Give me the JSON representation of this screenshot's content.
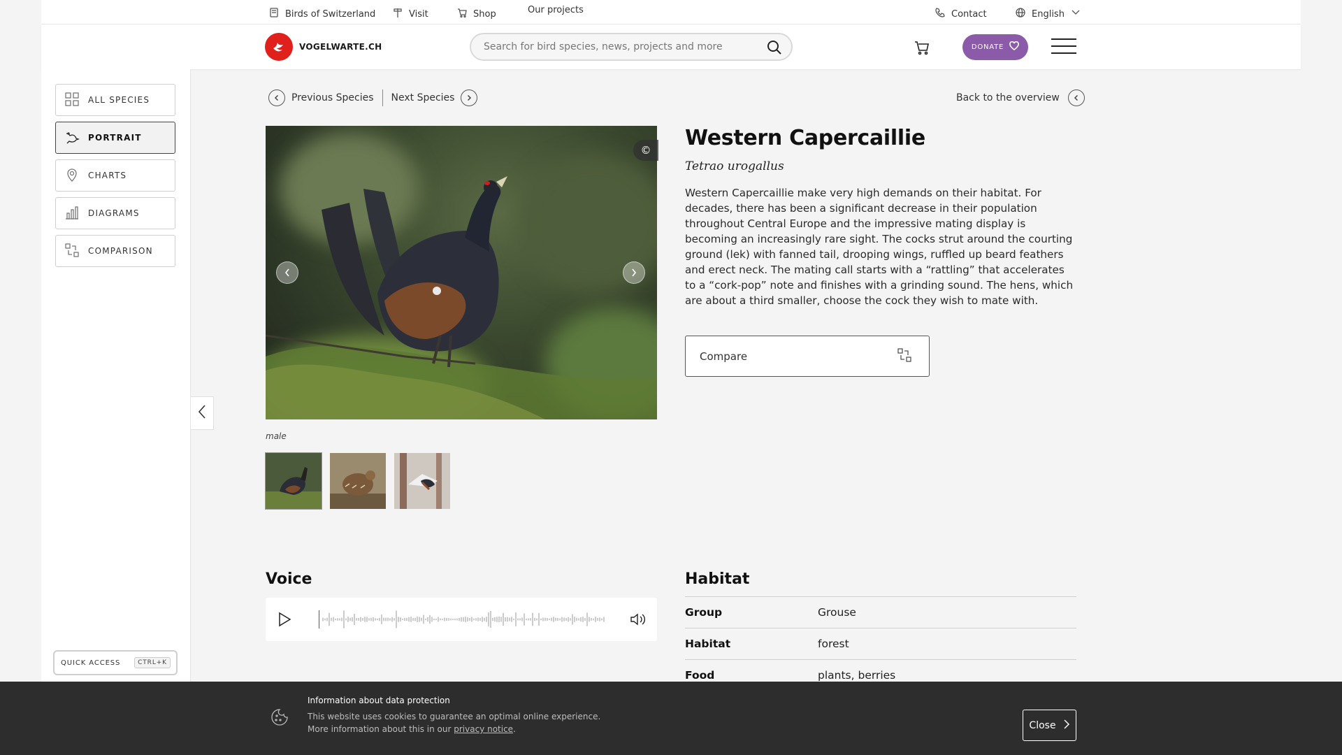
{
  "utility_bar": {
    "birds_of_switzerland": "Birds of Switzerland",
    "visit": "Visit",
    "shop": "Shop",
    "our_projects": "Our projects",
    "contact": "Contact",
    "language": "English"
  },
  "header": {
    "logo_text": "VOGELWARTE.CH",
    "search_placeholder": "Search for bird species, news, projects and more",
    "donate_label": "DONATE"
  },
  "sidebar": {
    "items": [
      {
        "label": "ALL SPECIES",
        "icon": "grid-icon",
        "active": false
      },
      {
        "label": "PORTRAIT",
        "icon": "bird-icon",
        "active": true
      },
      {
        "label": "CHARTS",
        "icon": "map-pin-icon",
        "active": false
      },
      {
        "label": "DIAGRAMS",
        "icon": "bar-chart-icon",
        "active": false
      },
      {
        "label": "COMPARISON",
        "icon": "compare-icon",
        "active": false
      }
    ],
    "quick_access_label": "QUICK ACCESS",
    "quick_access_shortcut": "CTRL+K"
  },
  "species_nav": {
    "previous": "Previous Species",
    "next": "Next Species",
    "back": "Back to the overview"
  },
  "species": {
    "name": "Western Capercaillie",
    "latin": "Tetrao urogallus",
    "description": "Western Capercaillie make very high demands on their habitat. For decades, there has been a significant decrease in their population throughout Central Europe and the impressive mating display is becoming an increasingly rare sight. The cocks strut around the courting ground (lek) with fanned tail, drooping wings, ruffled up beard feathers and erect neck. The mating call starts with a “rattling” that accelerates to a “cork-pop” note and finishes with a grinding sound. The hens, which are about a third smaller, choose the cock they wish to mate with.",
    "image_caption": "male",
    "copyright_symbol": "©",
    "compare_label": "Compare"
  },
  "voice": {
    "title": "Voice"
  },
  "habitat": {
    "title": "Habitat",
    "rows": [
      {
        "key": "Group",
        "value": "Grouse"
      },
      {
        "key": "Habitat",
        "value": "forest"
      },
      {
        "key": "Food",
        "value": "plants, berries"
      }
    ]
  },
  "cookie": {
    "title": "Information about data protection",
    "line1": "This website uses cookies to guarantee an optimal online experience.",
    "line2_prefix": "More information about this in our ",
    "link": "privacy notice",
    "line2_suffix": ".",
    "close_label": "Close"
  },
  "colors": {
    "brand_red": "#e0201b",
    "donate_purple": "#8b5aa8",
    "banner_bg": "#2d2d2d"
  }
}
